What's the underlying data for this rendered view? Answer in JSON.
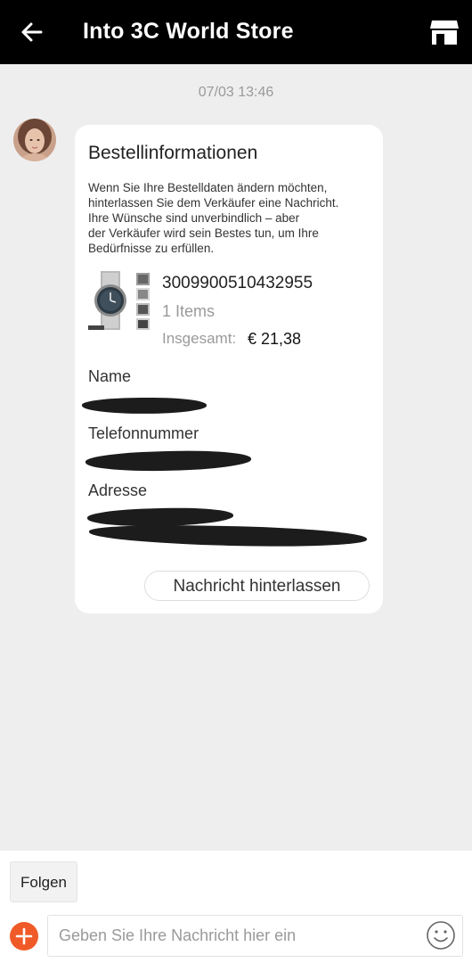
{
  "header": {
    "title": "Into 3C World Store",
    "back_icon": "arrow-left-icon",
    "store_icon": "store-icon"
  },
  "chat": {
    "timestamp": "07/03 13:46"
  },
  "order_card": {
    "heading": "Bestellinformationen",
    "description": "Wenn Sie Ihre Bestelldaten ändern möchten,\nhinterlassen Sie dem Verkäufer eine Nachricht.\nIhre Wünsche sind unverbindlich – aber\nder Verkäufer wird sein Bestes tun, um Ihre\nBedürfnisse zu erfüllen.",
    "order_id": "3009900510432955",
    "items": "1 Items",
    "total_label": "Insgesamt:",
    "total_value": "€ 21,38",
    "name_label": "Name",
    "phone_label": "Telefonnummer",
    "address_label": "Adresse",
    "leave_message_button": "Nachricht hinterlassen"
  },
  "bottom_bar": {
    "follow_button": "Folgen",
    "input_placeholder": "Geben Sie Ihre Nachricht hier ein",
    "plus_icon": "plus-icon",
    "emoji_icon": "smiley-icon"
  },
  "colors": {
    "header_bg": "#000000",
    "page_bg": "#eeeeee",
    "accent": "#f05a28"
  }
}
